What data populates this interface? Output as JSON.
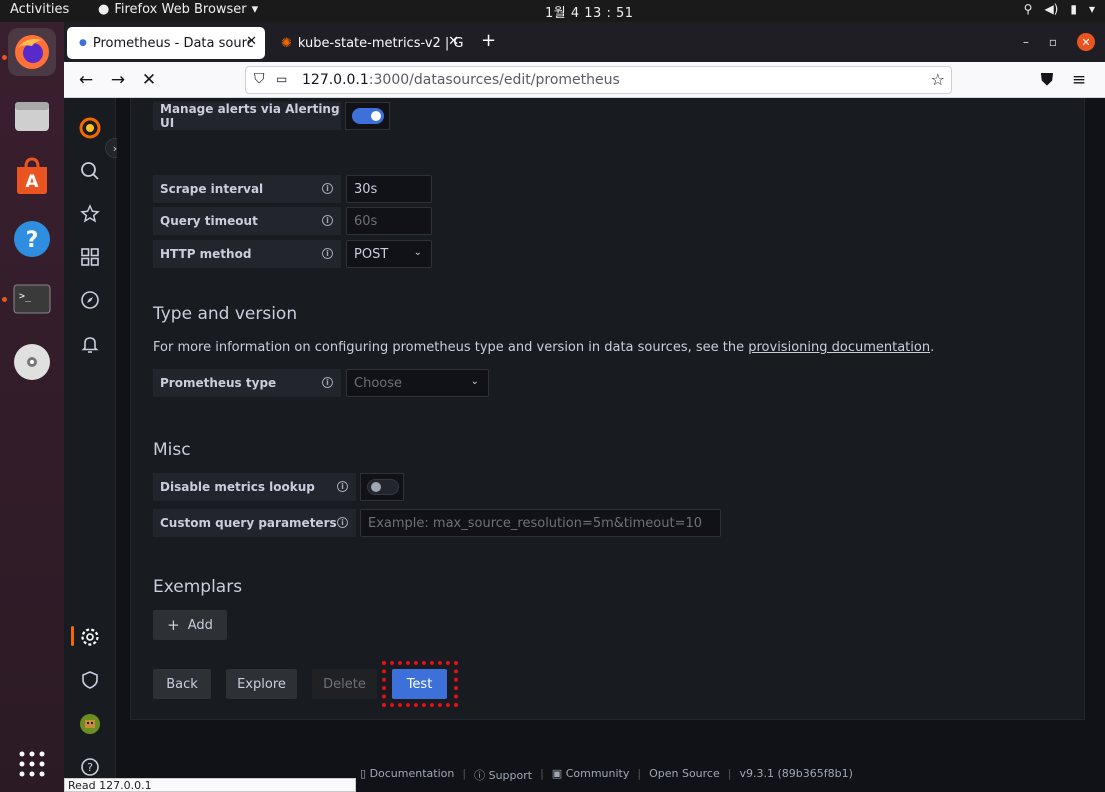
{
  "topbar": {
    "activities": "Activities",
    "app_name": "Firefox Web Browser",
    "clock": "1월 4  13 : 51"
  },
  "browser": {
    "tabs": [
      {
        "label": "Prometheus - Data sourc",
        "active": true
      },
      {
        "label": "kube-state-metrics-v2 | G",
        "active": false
      }
    ],
    "url_host": "127.0.0.1",
    "url_path": ":3000/datasources/edit/prometheus",
    "status_text": "Read 127.0.0.1"
  },
  "form": {
    "alerting": {
      "label": "Manage alerts via Alerting UI",
      "enabled": true
    },
    "scrape_interval": {
      "label": "Scrape interval",
      "value": "30s"
    },
    "query_timeout": {
      "label": "Query timeout",
      "placeholder": "60s"
    },
    "http_method": {
      "label": "HTTP method",
      "value": "POST"
    },
    "type_version": {
      "heading": "Type and version",
      "desc_prefix": "For more information on configuring prometheus type and version in data sources, see the ",
      "link": "provisioning documentation",
      "desc_suffix": "."
    },
    "prometheus_type": {
      "label": "Prometheus type",
      "placeholder": "Choose"
    },
    "misc": {
      "heading": "Misc"
    },
    "disable_metrics_lookup": {
      "label": "Disable metrics lookup",
      "enabled": false
    },
    "custom_query": {
      "label": "Custom query parameters",
      "placeholder": "Example: max_source_resolution=5m&timeout=10"
    },
    "exemplars": {
      "heading": "Exemplars",
      "add_label": "Add"
    }
  },
  "actions": {
    "back": "Back",
    "explore": "Explore",
    "delete": "Delete",
    "test": "Test"
  },
  "footer": {
    "documentation": "Documentation",
    "support": "Support",
    "community": "Community",
    "open_source": "Open Source",
    "version": "v9.3.1 (89b365f8b1)"
  },
  "colors": {
    "primary": "#3d71d9",
    "highlight": "#e2101a",
    "ubuntu_orange": "#e95420"
  }
}
